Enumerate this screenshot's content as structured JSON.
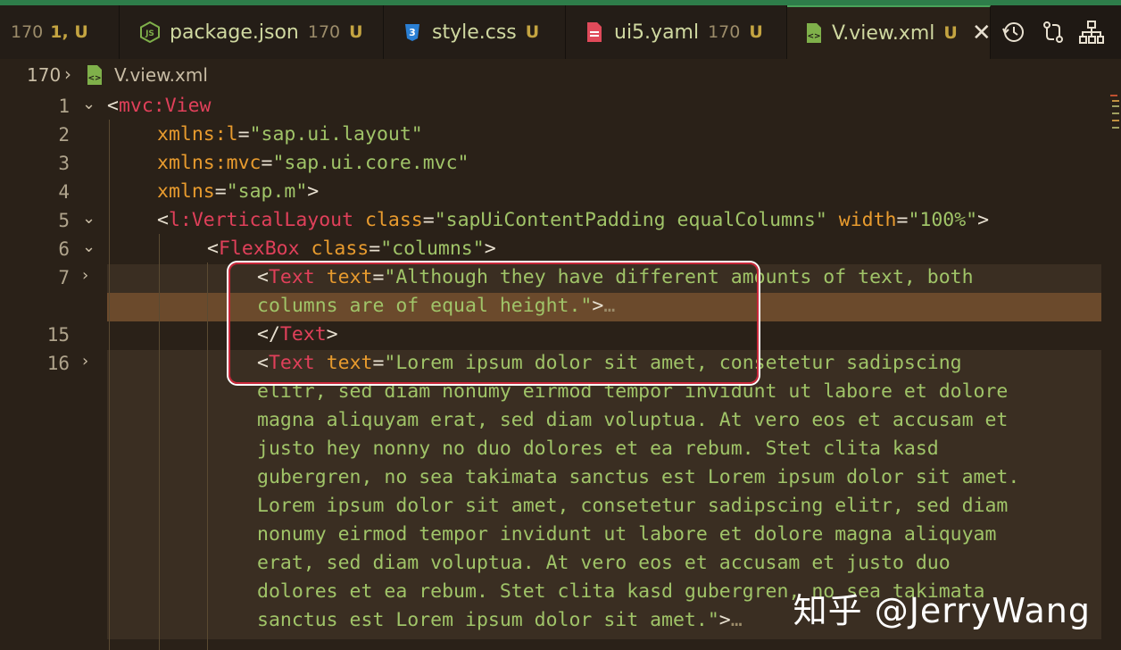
{
  "tabs": [
    {
      "name": "",
      "count": "170",
      "status": "1, U",
      "icon": "generic"
    },
    {
      "name": "package.json",
      "count": "170",
      "status": "U",
      "icon": "nodejs-icon"
    },
    {
      "name": "style.css",
      "count": "",
      "status": "U",
      "icon": "css-icon"
    },
    {
      "name": "ui5.yaml",
      "count": "170",
      "status": "U",
      "icon": "yaml-icon"
    },
    {
      "name": "V.view.xml",
      "count": "",
      "status": "U",
      "icon": "xml-icon",
      "active": true
    }
  ],
  "toolbar": {
    "icons": [
      "history-icon",
      "compare-changes-icon",
      "hierarchy-icon"
    ]
  },
  "breadcrumb": {
    "folder": "170",
    "file": "V.view.xml"
  },
  "lines": [
    {
      "num": "1",
      "fold": "open"
    },
    {
      "num": "2",
      "fold": ""
    },
    {
      "num": "3",
      "fold": ""
    },
    {
      "num": "4",
      "fold": ""
    },
    {
      "num": "5",
      "fold": "open"
    },
    {
      "num": "6",
      "fold": "open"
    },
    {
      "num": "7",
      "fold": "closed"
    },
    {
      "num": "",
      "fold": ""
    },
    {
      "num": "15",
      "fold": ""
    },
    {
      "num": "16",
      "fold": "closed"
    }
  ],
  "code": {
    "l1_tag": "mvc:View",
    "l2_attr": "xmlns:l",
    "l2_val": "\"sap.ui.layout\"",
    "l3_attr": "xmlns:mvc",
    "l3_val": "\"sap.ui.core.mvc\"",
    "l4_attr": "xmlns",
    "l4_val": "\"sap.m\"",
    "l5_tag": "l:VerticalLayout",
    "l5_attr1": "class",
    "l5_val1": "\"sapUiContentPadding equalColumns\"",
    "l5_attr2": "width",
    "l5_val2": "\"100%\"",
    "l6_tag": "FlexBox",
    "l6_attr": "class",
    "l6_val": "\"columns\"",
    "l7_tag": "Text",
    "l7_attr": "text",
    "l7_val": "\"Although they have different amounts of text, both",
    "l7b_val": "columns are of equal height.\"",
    "ellipsis": "…",
    "l15_tag": "Text",
    "l16_tag": "Text",
    "l16_attr": "text",
    "l16_val": "\"Lorem ipsum dolor sit amet, consetetur sadipscing",
    "wrap": [
      "elitr, sed diam nonumy eirmod tempor invidunt ut labore et dolore",
      "magna aliquyam erat, sed diam voluptua. At vero eos et accusam et",
      "justo hey nonny no duo dolores et ea rebum. Stet clita kasd",
      "gubergren, no sea takimata sanctus est Lorem ipsum dolor sit amet.",
      "Lorem ipsum dolor sit amet, consetetur sadipscing elitr, sed diam",
      "nonumy eirmod tempor invidunt ut labore et dolore magna aliquyam",
      "erat, sed diam voluptua. At vero eos et accusam et justo duo",
      "dolores et ea rebum. Stet clita kasd gubergren, no sea takimata",
      "sanctus est Lorem ipsum dolor sit amet.\""
    ]
  },
  "watermark": "知乎 @JerryWang",
  "colors": {
    "tag": "#e0405a",
    "attr": "#e89b2e",
    "string": "#a0c468",
    "highlight": "#6b4a2c",
    "box": "#c8283a"
  }
}
